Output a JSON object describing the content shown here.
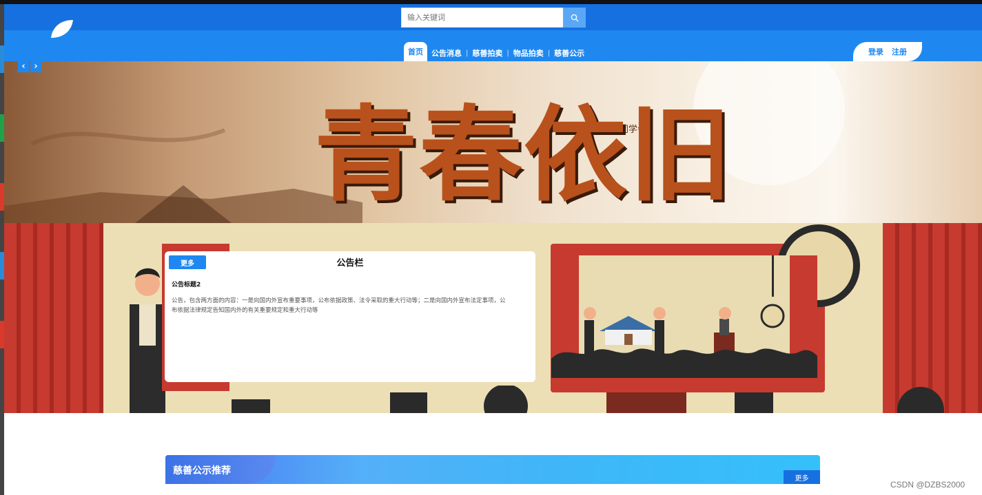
{
  "header": {
    "search": {
      "placeholder": "输入关键词"
    },
    "nav": [
      {
        "label": "首页",
        "active": true
      },
      {
        "label": "公告消息",
        "active": false
      },
      {
        "label": "慈善拍卖",
        "active": false
      },
      {
        "label": "物品拍卖",
        "active": false
      },
      {
        "label": "慈善公示",
        "active": false
      }
    ],
    "auth": {
      "login": "登录",
      "register": "注册"
    }
  },
  "banner": {
    "title": "青春依旧",
    "subtitle": "《同学会》",
    "prev_icon": "chevron-left-icon",
    "next_icon": "chevron-right-icon"
  },
  "notice_board": {
    "more_label": "更多",
    "title": "公告栏",
    "item_title": "公告标题2",
    "item_body": "公告，包含两方面的内容：一是向国内外宣布重要事项，公布依据政策、法令采取的重大行动等；二是向国内外宣布法定事项，公布依据法律规定告知国内外的有关重要规定和重大行动等"
  },
  "charity_section": {
    "title": "慈善公示推荐",
    "more_label": "更多"
  },
  "watermark": "CSDN @DZBS2000",
  "colors": {
    "primary": "#1e88f0",
    "header_top": "#1670e0",
    "curtain": "#c73a2f",
    "stage": "#ecdfb6"
  }
}
